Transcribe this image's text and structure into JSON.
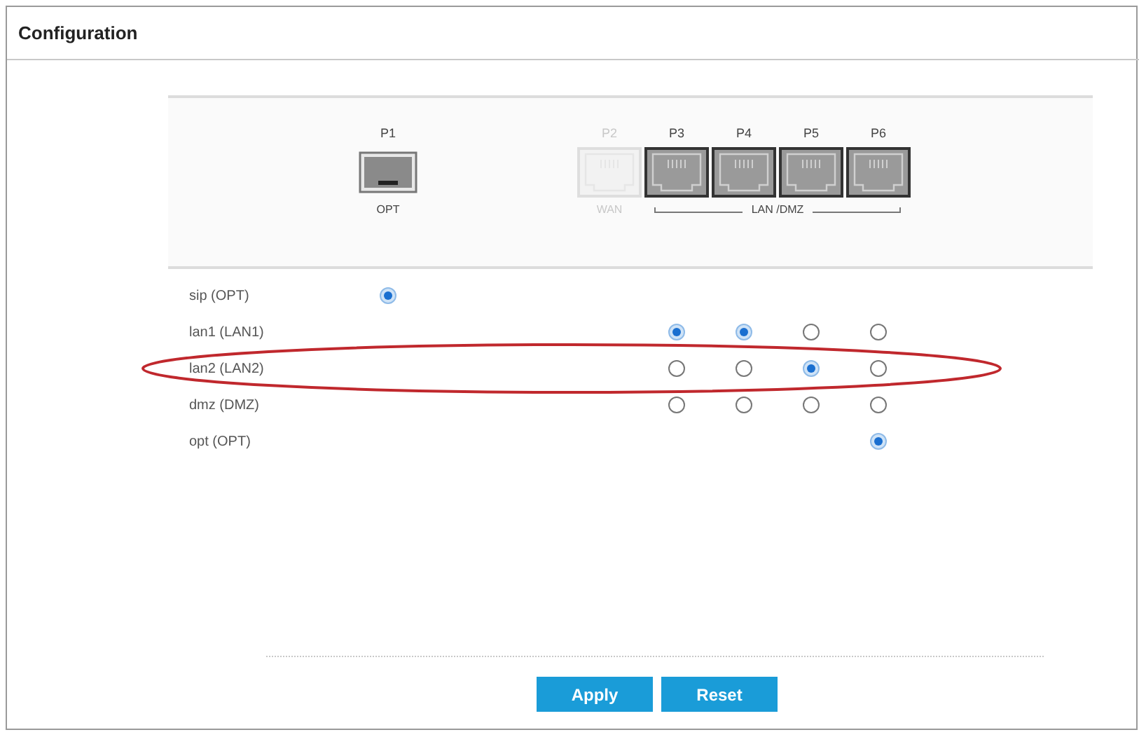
{
  "title": "Configuration",
  "ports": [
    {
      "label": "P1",
      "kind": "sfp",
      "disabled": false
    },
    {
      "label": "P2",
      "kind": "rj45",
      "disabled": true
    },
    {
      "label": "P3",
      "kind": "rj45",
      "disabled": false
    },
    {
      "label": "P4",
      "kind": "rj45",
      "disabled": false
    },
    {
      "label": "P5",
      "kind": "rj45",
      "disabled": false
    },
    {
      "label": "P6",
      "kind": "rj45",
      "disabled": false
    }
  ],
  "port_groups": [
    {
      "label": "OPT",
      "disabled": false
    },
    {
      "label": "WAN",
      "disabled": true
    },
    {
      "label": "LAN /DMZ",
      "disabled": false
    }
  ],
  "rows": [
    {
      "label": "sip (OPT)",
      "circled": false,
      "radios": [
        {
          "kind": "radio",
          "selected": true
        },
        {
          "kind": "none"
        },
        {
          "kind": "none"
        },
        {
          "kind": "none"
        },
        {
          "kind": "none"
        },
        {
          "kind": "none"
        }
      ]
    },
    {
      "label": "lan1 (LAN1)",
      "circled": false,
      "radios": [
        {
          "kind": "none"
        },
        {
          "kind": "none"
        },
        {
          "kind": "radio",
          "selected": true
        },
        {
          "kind": "radio",
          "selected": true
        },
        {
          "kind": "radio",
          "selected": false
        },
        {
          "kind": "radio",
          "selected": false
        }
      ]
    },
    {
      "label": "lan2 (LAN2)",
      "circled": true,
      "radios": [
        {
          "kind": "none"
        },
        {
          "kind": "none"
        },
        {
          "kind": "radio",
          "selected": false
        },
        {
          "kind": "radio",
          "selected": false
        },
        {
          "kind": "radio",
          "selected": true
        },
        {
          "kind": "radio",
          "selected": false
        }
      ]
    },
    {
      "label": "dmz (DMZ)",
      "circled": false,
      "radios": [
        {
          "kind": "none"
        },
        {
          "kind": "none"
        },
        {
          "kind": "radio",
          "selected": false
        },
        {
          "kind": "radio",
          "selected": false
        },
        {
          "kind": "radio",
          "selected": false
        },
        {
          "kind": "radio",
          "selected": false
        }
      ]
    },
    {
      "label": "opt (OPT)",
      "circled": false,
      "radios": [
        {
          "kind": "none"
        },
        {
          "kind": "none"
        },
        {
          "kind": "none"
        },
        {
          "kind": "none"
        },
        {
          "kind": "none"
        },
        {
          "kind": "radio",
          "selected": true
        }
      ]
    }
  ],
  "buttons": [
    {
      "label": "Apply"
    },
    {
      "label": "Reset"
    }
  ]
}
